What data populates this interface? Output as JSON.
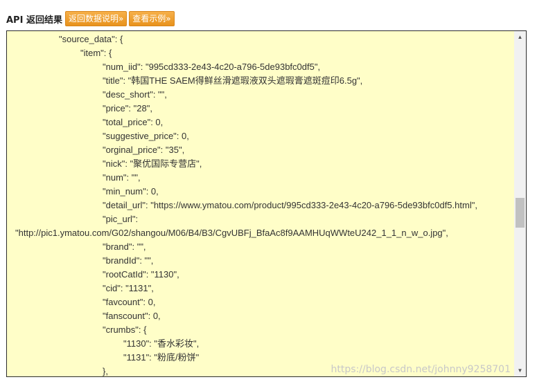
{
  "header": {
    "title": "API 返回结果",
    "buttons": [
      "返回数据说明»",
      "查看示例»"
    ]
  },
  "lines": [
    "\"source_data\": {",
    "\"item\": {",
    "\"num_iid\": \"995cd333-2e43-4c20-a796-5de93bfc0df5\",",
    "\"title\": \"韩国THE SAEM得鲜丝滑遮瑕液双头遮瑕膏遮斑痘印6.5g\",",
    "\"desc_short\": \"\",",
    "\"price\": \"28\",",
    "\"total_price\": 0,",
    "\"suggestive_price\": 0,",
    "\"orginal_price\": \"35\",",
    "\"nick\": \"聚优国际专营店\",",
    "\"num\": \"\",",
    "\"min_num\": 0,",
    "\"detail_url\": \"https://www.ymatou.com/product/995cd333-2e43-4c20-a796-5de93bfc0df5.html\",",
    "\"pic_url\":",
    "\"http://pic1.ymatou.com/G02/shangou/M06/B4/B3/CgvUBFj_BfaAc8f9AAMHUqWWteU242_1_1_n_w_o.jpg\",",
    "\"brand\": \"\",",
    "\"brandId\": \"\",",
    "\"rootCatId\": \"1130\",",
    "\"cid\": \"1131\",",
    "\"favcount\": 0,",
    "\"fanscount\": 0,",
    "\"crumbs\": {",
    "\"1130\": \"香水彩妆\",",
    "\"1131\": \"粉底/粉饼\"",
    "},"
  ],
  "watermark": "https://blog.csdn.net/johnny9258701",
  "icons": {
    "scroll_up": "scroll-up-arrow-icon",
    "scroll_down": "scroll-down-arrow-icon"
  }
}
